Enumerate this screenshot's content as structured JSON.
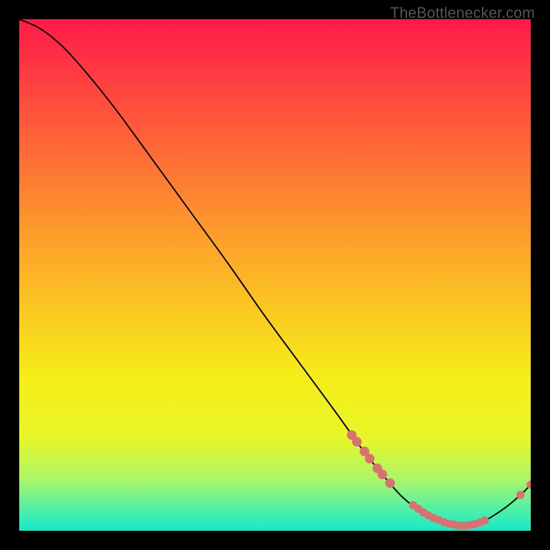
{
  "watermark": "TheBottlenecker.com",
  "chart_data": {
    "type": "line",
    "title": "",
    "xlabel": "",
    "ylabel": "",
    "xlim": [
      0,
      100
    ],
    "ylim": [
      0,
      100
    ],
    "background": {
      "gradient_stops": [
        {
          "pos": 0.0,
          "color": "#fe1a49"
        },
        {
          "pos": 0.45,
          "color": "#fda629"
        },
        {
          "pos": 0.7,
          "color": "#f6ed19"
        },
        {
          "pos": 0.82,
          "color": "#e7f628"
        },
        {
          "pos": 0.9,
          "color": "#a9f66a"
        },
        {
          "pos": 0.96,
          "color": "#4df0a8"
        },
        {
          "pos": 1.0,
          "color": "#17e9ca"
        }
      ]
    },
    "series": [
      {
        "name": "curve",
        "type": "line",
        "color": "#000000",
        "points": [
          {
            "x": 0.0,
            "y": 100.0
          },
          {
            "x": 3.5,
            "y": 98.5
          },
          {
            "x": 7.0,
            "y": 96.0
          },
          {
            "x": 11.0,
            "y": 92.0
          },
          {
            "x": 18.0,
            "y": 83.5
          },
          {
            "x": 25.0,
            "y": 74.0
          },
          {
            "x": 33.0,
            "y": 63.0
          },
          {
            "x": 41.0,
            "y": 52.0
          },
          {
            "x": 48.0,
            "y": 42.0
          },
          {
            "x": 55.0,
            "y": 32.5
          },
          {
            "x": 62.0,
            "y": 23.0
          },
          {
            "x": 67.0,
            "y": 16.0
          },
          {
            "x": 71.0,
            "y": 11.0
          },
          {
            "x": 75.0,
            "y": 6.5
          },
          {
            "x": 79.0,
            "y": 3.5
          },
          {
            "x": 83.0,
            "y": 1.5
          },
          {
            "x": 87.0,
            "y": 1.0
          },
          {
            "x": 91.0,
            "y": 2.0
          },
          {
            "x": 95.0,
            "y": 4.5
          },
          {
            "x": 98.0,
            "y": 7.0
          },
          {
            "x": 100.0,
            "y": 9.0
          }
        ]
      },
      {
        "name": "markers-upper",
        "type": "scatter",
        "color": "#d87271",
        "radius": 7,
        "points": [
          {
            "x": 65.0,
            "y": 18.7
          },
          {
            "x": 66.0,
            "y": 17.4
          },
          {
            "x": 67.5,
            "y": 15.5
          },
          {
            "x": 68.5,
            "y": 14.1
          },
          {
            "x": 70.0,
            "y": 12.2
          },
          {
            "x": 71.0,
            "y": 11.0
          },
          {
            "x": 72.5,
            "y": 9.3
          }
        ]
      },
      {
        "name": "markers-lower",
        "type": "scatter",
        "color": "#d87271",
        "radius": 6,
        "points": [
          {
            "x": 77.0,
            "y": 5.0
          },
          {
            "x": 78.0,
            "y": 4.3
          },
          {
            "x": 79.0,
            "y": 3.6
          },
          {
            "x": 80.0,
            "y": 3.0
          },
          {
            "x": 81.0,
            "y": 2.5
          },
          {
            "x": 82.0,
            "y": 2.1
          },
          {
            "x": 83.0,
            "y": 1.7
          },
          {
            "x": 84.0,
            "y": 1.4
          },
          {
            "x": 85.0,
            "y": 1.2
          },
          {
            "x": 86.0,
            "y": 1.0
          },
          {
            "x": 87.0,
            "y": 1.0
          },
          {
            "x": 88.0,
            "y": 1.1
          },
          {
            "x": 89.0,
            "y": 1.3
          },
          {
            "x": 90.0,
            "y": 1.6
          },
          {
            "x": 91.0,
            "y": 2.0
          }
        ]
      },
      {
        "name": "markers-tail",
        "type": "scatter",
        "color": "#d87271",
        "radius": 6,
        "points": [
          {
            "x": 98.0,
            "y": 7.0
          },
          {
            "x": 100.0,
            "y": 9.0
          }
        ]
      }
    ]
  }
}
